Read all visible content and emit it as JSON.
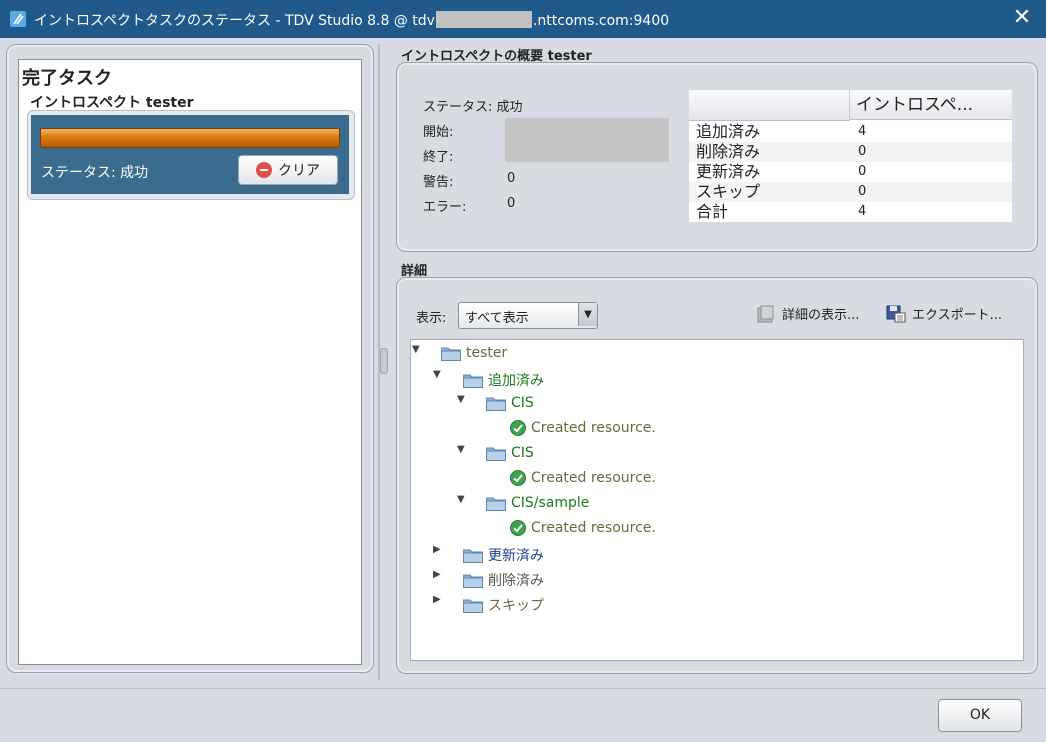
{
  "window": {
    "title_prefix": "イントロスペクトタスクのステータス - TDV Studio 8.8 @ tdv",
    "title_suffix": ".nttcoms.com:9400",
    "close_glyph": "✕"
  },
  "left": {
    "heading": "完了タスク",
    "task_name": "イントロスペクト tester",
    "task_status": "ステータス: 成功",
    "progress": 1.0,
    "clear_label": "クリア"
  },
  "summary": {
    "title": "イントロスペクトの概要  tester",
    "status": "ステータス: 成功",
    "start_label": "開始:",
    "end_label": "終了:",
    "warning_label": "警告:",
    "warning_value": "0",
    "error_label": "エラー:",
    "error_value": "0",
    "table": {
      "header": "イントロスペ...",
      "rows": [
        {
          "label": "追加済み",
          "value": "4"
        },
        {
          "label": "削除済み",
          "value": "0"
        },
        {
          "label": "更新済み",
          "value": "0"
        },
        {
          "label": "スキップ",
          "value": "0"
        },
        {
          "label": "合計",
          "value": "4"
        }
      ]
    }
  },
  "details": {
    "title": "詳細",
    "show_label": "表示:",
    "show_value": "すべて表示",
    "detail_view_label": "詳細の表示...",
    "export_label": "エクスポート...",
    "tree": {
      "root": "tester",
      "added": "追加済み",
      "cis1": "CIS",
      "created1": "Created resource.",
      "cis2": "CIS",
      "created2": "Created resource.",
      "cis_sample": "CIS/sample",
      "created3": "Created resource.",
      "updated": "更新済み",
      "deleted": "削除済み",
      "skipped": "スキップ"
    }
  },
  "ok_label": "OK",
  "colors": {
    "titlebar": "#1f5a8b",
    "task_card": "#3b6b8d",
    "progress": "#d97a0e",
    "added_green": "#1a7a1a",
    "updated_blue": "#1a3f8a",
    "muted": "#6b6b3a"
  }
}
